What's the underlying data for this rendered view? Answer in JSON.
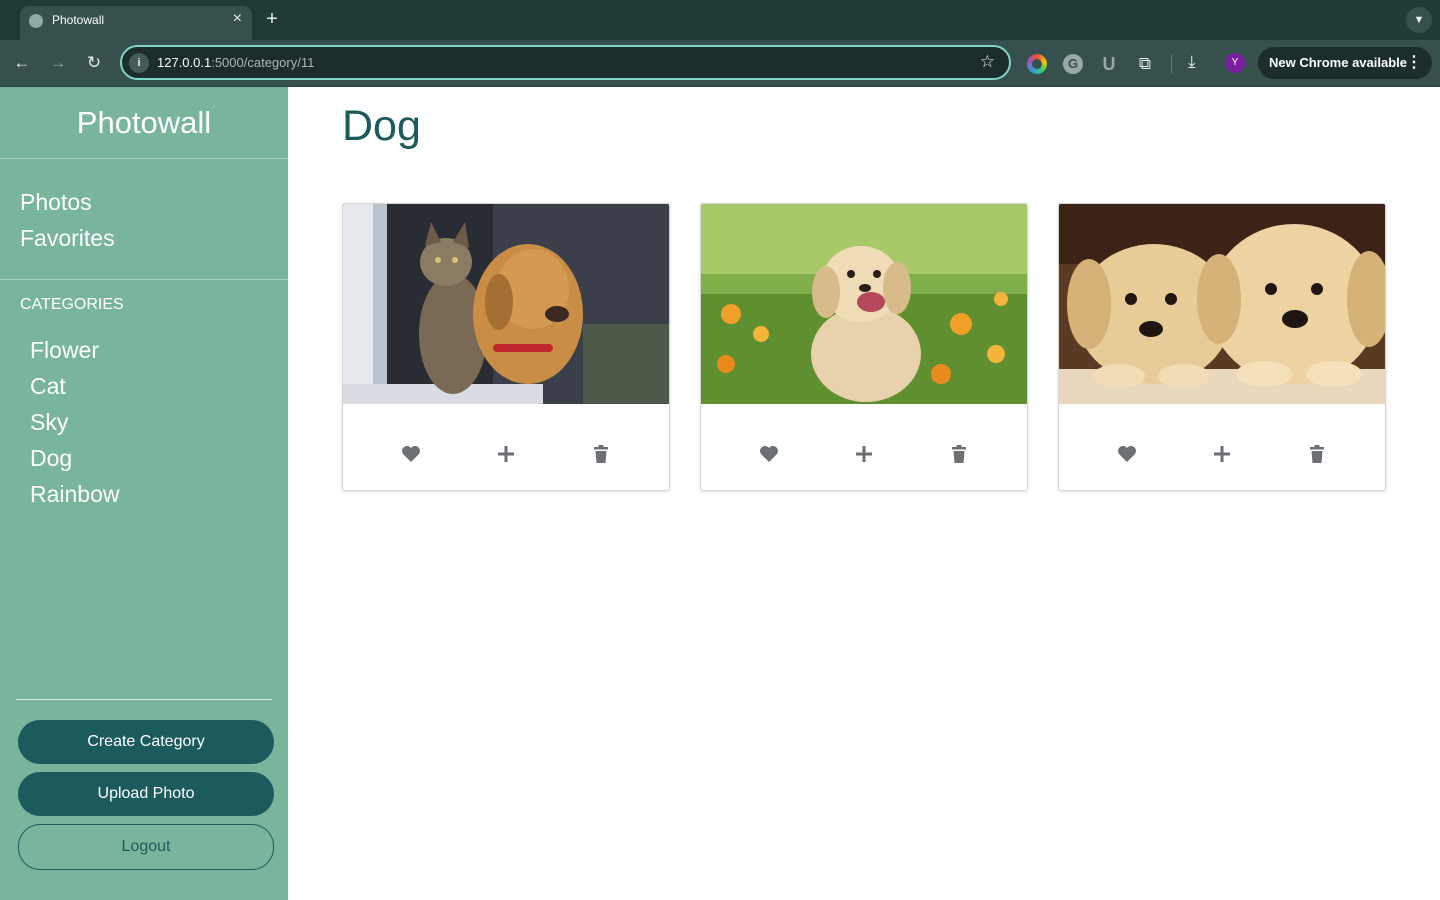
{
  "browser": {
    "tab_title": "Photowall",
    "url_host": "127.0.0.1",
    "url_path": ":5000/category/11",
    "profile_initial": "Y",
    "update_label": "New Chrome available"
  },
  "sidebar": {
    "brand": "Photowall",
    "nav": [
      {
        "label": "Photos"
      },
      {
        "label": "Favorites"
      }
    ],
    "categories_heading": "CATEGORIES",
    "categories": [
      {
        "label": "Flower"
      },
      {
        "label": "Cat"
      },
      {
        "label": "Sky"
      },
      {
        "label": "Dog"
      },
      {
        "label": "Rainbow"
      }
    ],
    "create_category_label": "Create Category",
    "upload_photo_label": "Upload Photo",
    "logout_label": "Logout"
  },
  "main": {
    "title": "Dog",
    "photos": [
      {
        "subject": "cat-and-dog-at-window"
      },
      {
        "subject": "puppy-in-flower-field"
      },
      {
        "subject": "two-golden-puppies"
      }
    ]
  },
  "colors": {
    "sidebar_bg": "#79b49c",
    "accent": "#1c5b5d",
    "icon_gray": "#6c6f74"
  }
}
